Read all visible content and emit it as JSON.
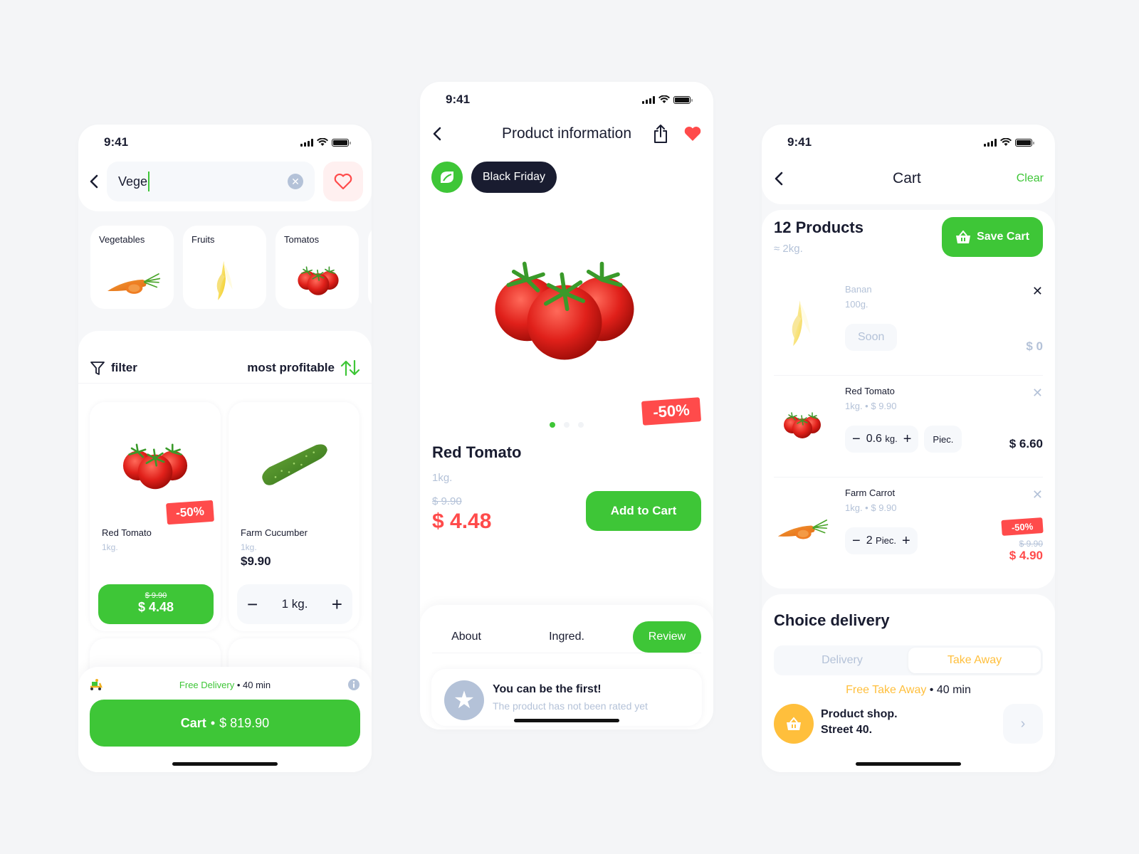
{
  "status_bar": {
    "time": "9:41"
  },
  "search_screen": {
    "search": {
      "value": "Vege",
      "placeholder": ""
    },
    "categories": [
      {
        "label": "Vegetables",
        "image": "carrot"
      },
      {
        "label": "Fruits",
        "image": "banana"
      },
      {
        "label": "Tomatos",
        "image": "tomato"
      }
    ],
    "filter_label": "filter",
    "sort_label": "most profitable",
    "products": [
      {
        "name": "Red Tomato",
        "weight": "1kg.",
        "discount": "-50%",
        "old_price": "$ 9.90",
        "price": "$ 4.48",
        "image": "tomato"
      },
      {
        "name": "Farm Cucumber",
        "weight": "1kg.",
        "price": "$9.90",
        "quantity": "1 kg.",
        "image": "cucumber"
      }
    ],
    "delivery": {
      "label": "Free Delivery",
      "separator": "•",
      "time": "40 min"
    },
    "cart_button": {
      "label": "Cart",
      "separator": "•",
      "total": "$ 819.90"
    }
  },
  "product_screen": {
    "title": "Product information",
    "tag": "Black Friday",
    "discount": "-50%",
    "slides": {
      "count": 3,
      "active": 1
    },
    "name": "Red Tomato",
    "weight": "1kg.",
    "old_price": "$ 9.90",
    "price": "$ 4.48",
    "add_to_cart": "Add to Cart",
    "tabs": [
      {
        "label": "About",
        "active": false
      },
      {
        "label": "Ingred.",
        "active": false
      },
      {
        "label": "Review",
        "active": true
      }
    ],
    "review": {
      "title": "You can be the first!",
      "subtitle": "The product has not been rated yet"
    }
  },
  "cart_screen": {
    "title": "Cart",
    "clear": "Clear",
    "count": "12 Products",
    "weight": "≈ 2kg.",
    "save_cart": "Save Cart",
    "items": [
      {
        "name": "Banan",
        "sub": "100g.",
        "status": "Soon",
        "price": "$ 0",
        "image": "banana",
        "available": false
      },
      {
        "name": "Red Tomato",
        "sub": "1kg. • $ 9.90",
        "qty": "0.6",
        "unit": "kg.",
        "alt_unit": "Piec.",
        "price": "$ 6.60",
        "image": "tomato"
      },
      {
        "name": "Farm Carrot",
        "sub": "1kg. • $ 9.90",
        "qty": "2",
        "unit": "Piec.",
        "discount": "-50%",
        "old_price": "$ 9.90",
        "price": "$ 4.90",
        "image": "carrot"
      }
    ],
    "delivery": {
      "title": "Choice delivery",
      "options": [
        "Delivery",
        "Take Away"
      ],
      "selected": "Take Away",
      "info_label": "Free Take Away",
      "separator": "•",
      "info_time": "40 min",
      "shop_line1": "Product shop.",
      "shop_line2": "Street 40."
    }
  },
  "colors": {
    "accent": "#3ec637",
    "danger": "#ff4b4b",
    "dark": "#191c30",
    "muted": "#b4c2d8",
    "takeaway": "#ffbf3c"
  }
}
